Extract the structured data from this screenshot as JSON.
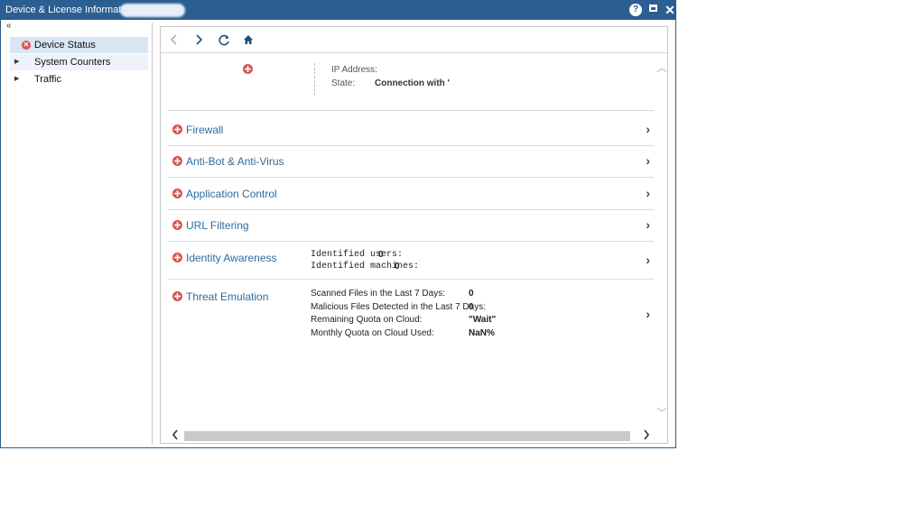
{
  "window": {
    "title": "Device & License Information -",
    "help_icon": "question-icon",
    "max_icon": "maximize-icon",
    "close_icon": "close-icon",
    "collapse_glyph": "«"
  },
  "sidebar": {
    "items": [
      {
        "label": "Device Status",
        "icon": "error-icon"
      },
      {
        "label": "System Counters",
        "icon": "caret-right-icon"
      },
      {
        "label": "Traffic",
        "icon": "caret-right-icon"
      }
    ]
  },
  "toolbar": {
    "back": "back-icon",
    "forward": "forward-icon",
    "refresh": "refresh-icon",
    "home": "home-icon"
  },
  "device": {
    "ip_label": "IP Address:",
    "state_label": "State:",
    "state_value": "Connection with '"
  },
  "blades": [
    {
      "name": "Firewall"
    },
    {
      "name": "Anti-Bot & Anti-Virus"
    },
    {
      "name": "Application Control"
    },
    {
      "name": "URL Filtering"
    },
    {
      "name": "Identity Awareness",
      "details": [
        {
          "label": "Identified users:",
          "value": "0"
        },
        {
          "label": "Identified machines:",
          "value": "0"
        }
      ]
    },
    {
      "name": "Threat Emulation",
      "details": [
        {
          "label": "Scanned Files in the Last 7 Days:",
          "value": "0"
        },
        {
          "label": "Malicious Files Detected in the Last 7 Days:",
          "value": "0"
        },
        {
          "label": "Remaining Quota on Cloud:",
          "value": "\"Wait\""
        },
        {
          "label": "Monthly Quota on Cloud Used:",
          "value": "NaN%"
        }
      ]
    }
  ],
  "colors": {
    "titlebar": "#2b5e91",
    "error": "#d9534f",
    "link": "#2f6b9c"
  }
}
